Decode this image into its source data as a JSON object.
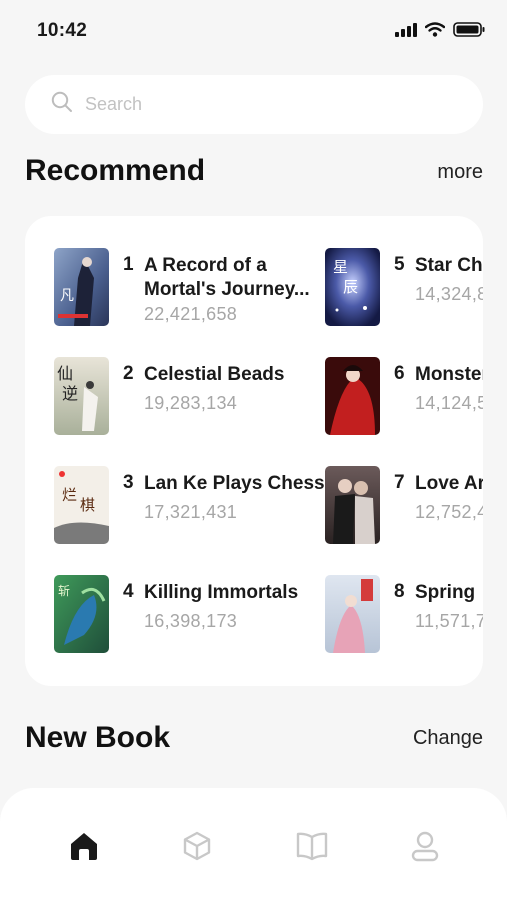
{
  "status_bar": {
    "time": "10:42"
  },
  "search": {
    "placeholder": "Search"
  },
  "recommend": {
    "title": "Recommend",
    "more_label": "more",
    "books": [
      {
        "rank": "1",
        "title": "A Record of a Mortal's Journey...",
        "count": "22,421,658"
      },
      {
        "rank": "2",
        "title": "Celestial Beads",
        "count": "19,283,134"
      },
      {
        "rank": "3",
        "title": "Lan Ke Plays Chess",
        "count": "17,321,431"
      },
      {
        "rank": "4",
        "title": "Killing Immortals",
        "count": "16,398,173"
      },
      {
        "rank": "5",
        "title": "Star Cha",
        "count": "14,324,8"
      },
      {
        "rank": "6",
        "title": "Monster",
        "count": "14,124,5"
      },
      {
        "rank": "7",
        "title": "Love Ar",
        "count": "12,752,4"
      },
      {
        "rank": "8",
        "title": "Spring",
        "count": "11,571,7"
      }
    ]
  },
  "new_book": {
    "title": "New Book",
    "change_label": "Change"
  },
  "nav": {
    "items": [
      {
        "icon": "home-icon",
        "active": true
      },
      {
        "icon": "cube-icon",
        "active": false
      },
      {
        "icon": "book-open-icon",
        "active": false
      },
      {
        "icon": "user-icon",
        "active": false
      }
    ]
  },
  "colors": {
    "background": "#f6f6f6",
    "card": "#ffffff",
    "count_text": "#a6a6a6",
    "inactive_icon": "#c8c8c8",
    "active_icon": "#1a1a1a"
  }
}
